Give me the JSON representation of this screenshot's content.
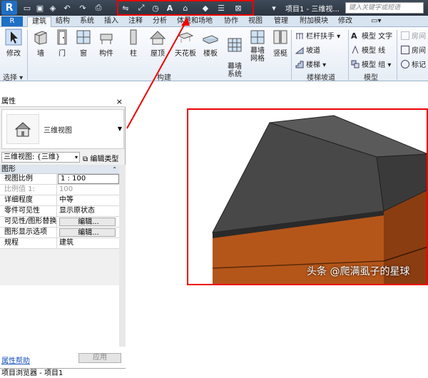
{
  "titlebar": {
    "app_logo": "R",
    "project_title": "项目1 - 三维视...",
    "search_placeholder": "键入关键字或短语",
    "quick_access": [
      "open-icon",
      "save-icon",
      "sync-icon",
      "undo-icon",
      "redo-icon",
      "print-icon",
      "measure-icon",
      "dimension-icon",
      "tag-icon",
      "text-icon",
      "3d-view-icon",
      "section-icon",
      "thin-lines-icon",
      "close-hidden-icon",
      "switch-window-icon"
    ]
  },
  "tabs": {
    "file": "R",
    "items": [
      "建筑",
      "结构",
      "系统",
      "插入",
      "注释",
      "分析",
      "体量和场地",
      "协作",
      "视图",
      "管理",
      "附加模块",
      "修改"
    ],
    "active_index": 0
  },
  "ribbon": {
    "modify": "修改",
    "select": "选择 ▾",
    "build_tools": [
      {
        "label": "墙"
      },
      {
        "label": "门"
      },
      {
        "label": "窗"
      },
      {
        "label": "构件"
      },
      {
        "label": "柱"
      },
      {
        "label": "屋顶"
      },
      {
        "label": "天花板"
      },
      {
        "label": "楼板"
      },
      {
        "label": "幕墙\n系统"
      },
      {
        "label": "幕墙\n网格"
      },
      {
        "label": "竖梃"
      }
    ],
    "build_panel": "构建",
    "circulation_items": [
      "栏杆扶手 ▾",
      "坡道",
      "楼梯 ▾"
    ],
    "circulation_panel": "楼梯坡道",
    "model_items": [
      "模型 文字",
      "模型 线",
      "模型 组 ▾"
    ],
    "model_panel": "模型",
    "room_items": [
      "房间",
      "房间",
      "标记"
    ]
  },
  "properties": {
    "title": "属性",
    "close": "×",
    "type_name": "三维视图",
    "view_selector": "三维视图: {三维}",
    "edit_type": "编辑类型",
    "section": "图形",
    "rows": [
      {
        "key": "视图比例",
        "value": "1 : 100"
      },
      {
        "key": "比例值 1:",
        "value": "100"
      },
      {
        "key": "详细程度",
        "value": "中等"
      },
      {
        "key": "零件可见性",
        "value": "显示原状态"
      },
      {
        "key": "可见性/图形替换",
        "value": "编辑..."
      },
      {
        "key": "图形显示选项",
        "value": "编辑..."
      },
      {
        "key": "规程",
        "value": "建筑"
      }
    ],
    "help": "属性帮助",
    "apply": "应用"
  },
  "project_browser": {
    "title": "项目浏览器 - 项目1"
  },
  "watermark": "头条 @爬满虱子的星球",
  "colors": {
    "highlight": "#e00000",
    "roof": "#3a3a3a",
    "wall": "#b4561a",
    "ribbon_bg": "#e6edf6"
  }
}
